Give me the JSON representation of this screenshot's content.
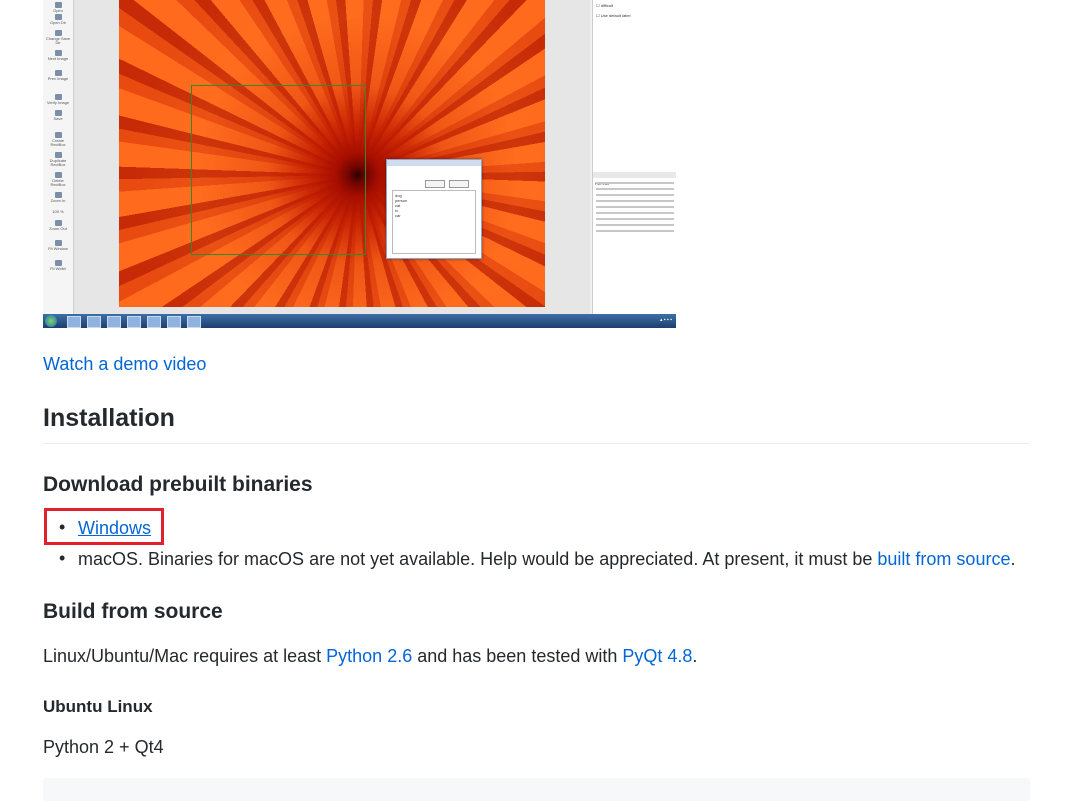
{
  "screenshot": {
    "toolbar_items": [
      "Open",
      "Open Dir",
      "Change Save Dir",
      "Next Image",
      "Prev Image",
      "Verify Image",
      "Save",
      "Create RectBox",
      "Duplicate RectBox",
      "Delete RectBox",
      "Zoom In",
      "100 %",
      "Zoom Out",
      "Fit Window",
      "Fit Width"
    ],
    "dialog_labels": [
      "dog",
      "person",
      "cat",
      "tv",
      "car"
    ],
    "checkbox_label": "Use default label",
    "file_list_title": "File List"
  },
  "links": {
    "demo": "Watch a demo video"
  },
  "installation": {
    "heading": "Installation",
    "download": {
      "heading": "Download prebuilt binaries",
      "windows": "Windows",
      "macos_text": "macOS. Binaries for macOS are not yet available. Help would be appreciated. At present, it must be ",
      "macos_link": "built from source",
      "macos_end": "."
    },
    "build": {
      "heading": "Build from source",
      "text1": "Linux/Ubuntu/Mac requires at least ",
      "python_link": "Python 2.6",
      "text2": " and has been tested with ",
      "pyqt_link": "PyQt 4.8",
      "text3": ".",
      "ubuntu_heading": "Ubuntu Linux",
      "python_qt": "Python 2 + Qt4"
    }
  },
  "colors": {
    "link": "#0366d6",
    "text": "#24292e",
    "highlight": "#e0202a",
    "code_bg": "#f6f8fa"
  }
}
